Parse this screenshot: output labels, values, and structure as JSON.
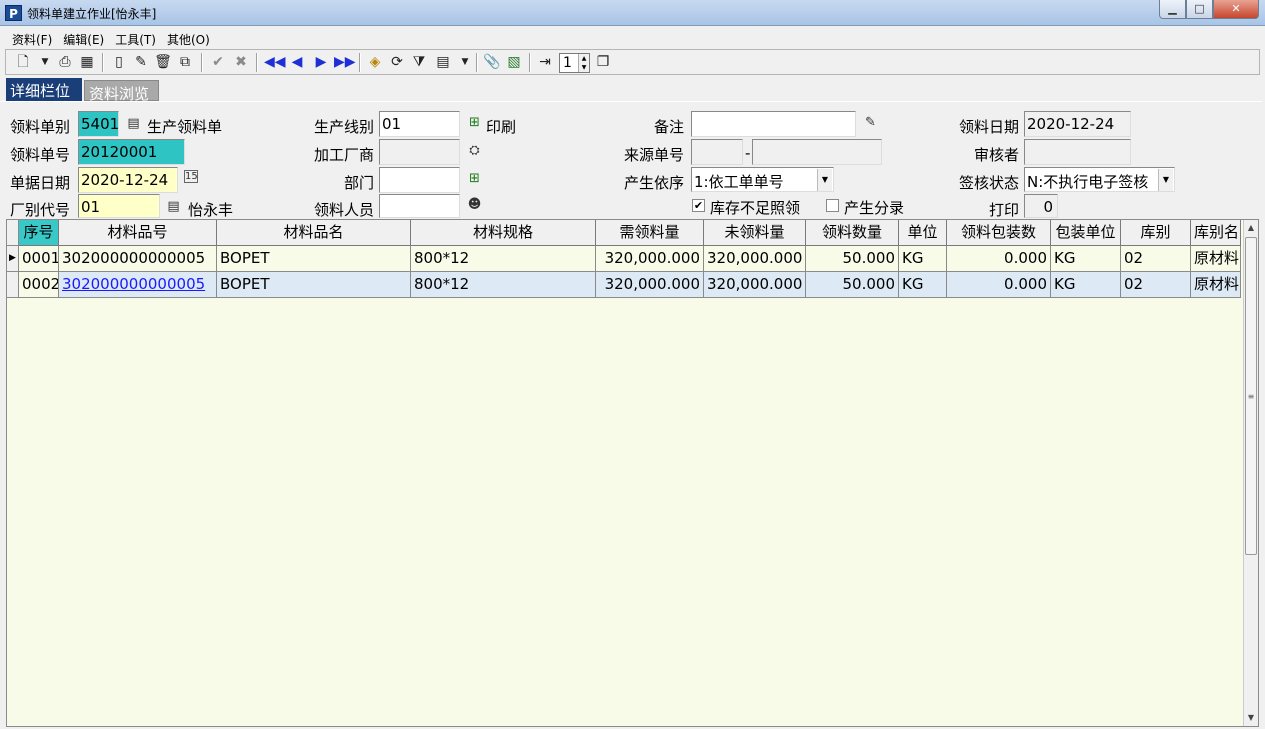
{
  "window": {
    "title": "领料单建立作业[怡永丰]",
    "app_icon": "P"
  },
  "menu": [
    "资料(F)",
    "编辑(E)",
    "工具(T)",
    "其他(O)"
  ],
  "toolbar": {
    "page_value": "1"
  },
  "tabs": {
    "detail": "详细栏位",
    "browse": "资料浏览"
  },
  "form": {
    "type_label": "领料单别",
    "type_code": "5401",
    "type_name": "生产领料单",
    "no_label": "领料单号",
    "no_value": "20120001",
    "doc_date_label": "单据日期",
    "doc_date_value": "2020-12-24",
    "factory_label": "厂别代号",
    "factory_code": "01",
    "factory_name": "怡永丰",
    "line_label": "生产线别",
    "line_value": "01",
    "line_name": "印刷",
    "processor_label": "加工厂商",
    "processor_value": "",
    "dept_label": "部门",
    "dept_value": "",
    "picker_label": "领料人员",
    "picker_value": "",
    "remark_label": "备注",
    "remark_value": "",
    "source_label": "来源单号",
    "source_dash": "-",
    "basis_label": "产生依序",
    "basis_value": "1:依工单单号",
    "stock_check_label": "库存不足照领",
    "stock_check": true,
    "entry_check_label": "产生分录",
    "entry_check": false,
    "pick_date_label": "领料日期",
    "pick_date_value": "2020-12-24",
    "auditor_label": "审核者",
    "auditor_value": "",
    "sign_label": "签核状态",
    "sign_value": "N:不执行电子签核",
    "print_label": "打印",
    "print_value": "0"
  },
  "grid": {
    "columns": [
      "序号",
      "材料品号",
      "材料品名",
      "材料规格",
      "需领料量",
      "未领料量",
      "领料数量",
      "单位",
      "领料包装数",
      "包装单位",
      "库别",
      "库别名"
    ],
    "rows": [
      [
        "0001",
        "302000000000005",
        "BOPET",
        "800*12",
        "320,000.000",
        "320,000.000",
        "50.000",
        "KG",
        "0.000",
        "KG",
        "02",
        "原材料"
      ],
      [
        "0002",
        "302000000000005",
        "BOPET",
        "800*12",
        "320,000.000",
        "320,000.000",
        "50.000",
        "KG",
        "0.000",
        "KG",
        "02",
        "原材料"
      ]
    ]
  }
}
